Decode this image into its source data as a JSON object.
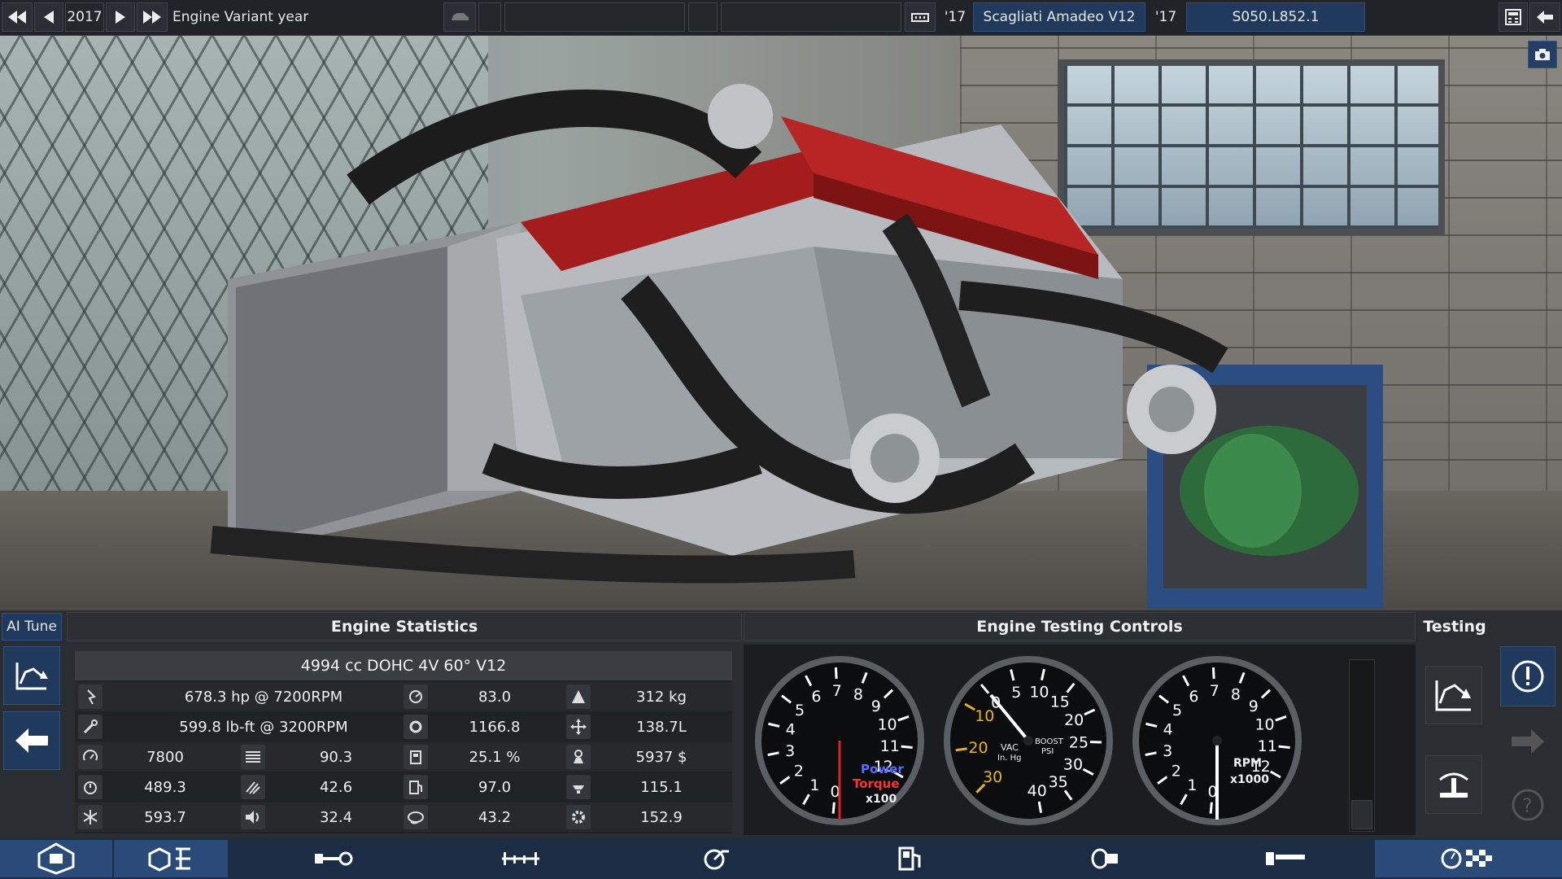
{
  "top_bar": {
    "year": "2017",
    "variant_label": "Engine Variant year",
    "year_short_1": "'17",
    "engine_name": "Scagliati Amadeo V12",
    "year_short_2": "'17",
    "engine_code": "S050.L852.1"
  },
  "panel": {
    "ai_tune_label": "AI Tune",
    "stats_header": "Engine Statistics",
    "controls_header": "Engine Testing Controls",
    "testing_header": "Testing"
  },
  "engine_stats": {
    "title": "4994 cc DOHC 4V 60° V12",
    "rows": [
      {
        "a_icon": "power-icon",
        "a": "678.3 hp @ 7200RPM",
        "b_icon": "economy-icon",
        "b": "83.0",
        "c_icon": "weight-icon",
        "c": "312 kg"
      },
      {
        "a_icon": "torque-wrench-icon",
        "a": "599.8 lb-ft @ 3200RPM",
        "b_icon": "engineering-icon",
        "b": "1166.8",
        "c_icon": "size-icon",
        "c": "138.7L"
      },
      {
        "a_icon": "rpm-gauge-icon",
        "a": "7800",
        "m_icon": "radiator-icon",
        "m": "90.3",
        "b_icon": "fuel-efficiency-icon",
        "b": "25.1 %",
        "c_icon": "cost-icon",
        "c": "5937 $"
      },
      {
        "a_icon": "responsiveness-icon",
        "a": "489.3",
        "m_icon": "smoothness-icon",
        "m": "42.6",
        "b_icon": "fuel-pump-icon",
        "b": "97.0",
        "c_icon": "service-icon",
        "c": "115.1"
      },
      {
        "a_icon": "cooling-icon",
        "a": "593.7",
        "m_icon": "loudness-icon",
        "m": "32.4",
        "b_icon": "emissions-icon",
        "b": "43.2",
        "c_icon": "reliability-icon",
        "c": "152.9"
      }
    ]
  },
  "gauges": {
    "dyno": {
      "ticks": [
        "0",
        "1",
        "2",
        "3",
        "4",
        "5",
        "6",
        "7",
        "8",
        "9",
        "10",
        "11",
        "12"
      ],
      "label_power": "Power",
      "label_torque": "Torque",
      "label_scale": "x100"
    },
    "boost": {
      "vac_ticks": [
        "10",
        "20",
        "30"
      ],
      "psi_ticks": [
        "0",
        "5",
        "10",
        "15",
        "20",
        "25",
        "30",
        "35",
        "40"
      ],
      "label_vac": "VAC",
      "label_vac_unit": "In. Hg",
      "label_boost": "BOOST",
      "label_psi": "PSI"
    },
    "rpm": {
      "ticks": [
        "0",
        "1",
        "2",
        "3",
        "4",
        "5",
        "6",
        "7",
        "8",
        "9",
        "10",
        "11",
        "12"
      ],
      "label_rpm": "RPM",
      "label_scale": "x1000"
    }
  },
  "colors": {
    "accent": "#1f3a5c",
    "power": "#5a6cff",
    "torque": "#ff3030",
    "boost_yellow": "#e6b422",
    "redline": "#e02020"
  }
}
